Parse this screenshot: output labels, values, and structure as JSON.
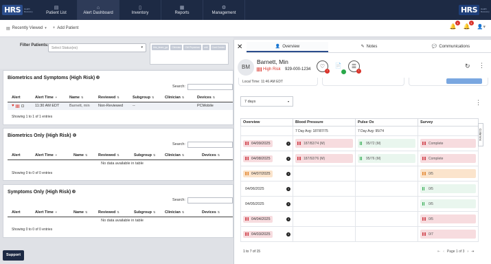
{
  "nav": {
    "logo_text": "HRS",
    "logo_sub": "Health Recovery Solutions",
    "items": [
      {
        "label": "Patient List",
        "icon": "list-icon"
      },
      {
        "label": "Alert Dashboard",
        "icon": "home-icon"
      },
      {
        "label": "Inventory",
        "icon": "tablet-icon"
      },
      {
        "label": "Reports",
        "icon": "chart-icon"
      },
      {
        "label": "Management",
        "icon": "gear-icon"
      }
    ],
    "right_logo": "HRS",
    "right_logo_sub": "Health Recovery Solutions"
  },
  "subbar": {
    "recently_viewed": "Recently Viewed",
    "add_patient": "Add Patient",
    "notif_count_1": "1",
    "notif_count_2": "1"
  },
  "filter": {
    "label": "Filter Patients:",
    "placeholder": "Select Status(es)",
    "chips": [
      "hhs_team_ga",
      "Clinician",
      "CM Physician",
      "unit",
      "Cost Center"
    ]
  },
  "panels": [
    {
      "title": "Biometrics and Symptoms (High Risk)",
      "search_label": "Search:",
      "columns": [
        "Alert",
        "Alert Time",
        "Name",
        "Reviewed",
        "Subgroup",
        "Clinician",
        "Devices"
      ],
      "rows": [
        {
          "alert_time": "11:30 AM EDT",
          "name": "Barnett, min",
          "reviewed": "Non-Reviewed",
          "subgroup": "--",
          "clinician": "",
          "devices": "PCMobile"
        }
      ],
      "showing": "Showing 1 to 1 of 1 entries"
    },
    {
      "title": "Biometrics Only (High Risk)",
      "search_label": "Search:",
      "columns": [
        "Alert",
        "Alert Time",
        "Name",
        "Reviewed",
        "Subgroup",
        "Clinician",
        "Devices"
      ],
      "no_data": "No data available in table",
      "showing": "Showing 0 to 0 of 0 entries"
    },
    {
      "title": "Symptoms Only (High Risk)",
      "search_label": "Search:",
      "columns": [
        "Alert",
        "Alert Time",
        "Name",
        "Reviewed",
        "Subgroup",
        "Clinician",
        "Devices"
      ],
      "no_data": "No data available in table",
      "showing": "Showing 0 to 0 of 0 entries"
    }
  ],
  "support_label": "Support",
  "overlay": {
    "tabs": [
      "Overview",
      "Notes",
      "Communications"
    ],
    "initials": "BM",
    "patient_name": "Barnett, Min",
    "risk": "High Risk",
    "phone": "929-000-1234",
    "status_badges": [
      "!",
      "",
      "!"
    ],
    "local_time": "Local Time: 11:46 AM EDT",
    "days_select": "7 days",
    "columns_tab": "Columns",
    "table": {
      "headers": [
        "Overview",
        "Blood Pressure",
        "Pulse Ox",
        "Survey"
      ],
      "avg": [
        "",
        "7 Day Avg: 187/87/75",
        "7 Day Avg: 95/74",
        ""
      ],
      "rows": [
        {
          "date": "04/09/2025",
          "level": "red",
          "bp": "187/82/74 (M)",
          "bp_level": "red",
          "po": "95/72 (M)",
          "po_level": "green",
          "survey": "Complete",
          "survey_level": "red"
        },
        {
          "date": "04/08/2025",
          "level": "red",
          "bp": "187/92/76 (M)",
          "bp_level": "red",
          "po": "95/76 (M)",
          "po_level": "green",
          "survey": "Complete",
          "survey_level": "red"
        },
        {
          "date": "04/07/2025",
          "level": "orange",
          "bp": "",
          "bp_level": "",
          "po": "",
          "po_level": "",
          "survey": "0/5",
          "survey_level": "orange"
        },
        {
          "date": "04/06/2025",
          "level": "none",
          "bp": "",
          "bp_level": "",
          "po": "",
          "po_level": "",
          "survey": "0/5",
          "survey_level": "green"
        },
        {
          "date": "04/05/2025",
          "level": "none",
          "bp": "",
          "bp_level": "",
          "po": "",
          "po_level": "",
          "survey": "0/5",
          "survey_level": "green"
        },
        {
          "date": "04/04/2025",
          "level": "red",
          "bp": "",
          "bp_level": "",
          "po": "",
          "po_level": "",
          "survey": "0/5",
          "survey_level": "red"
        },
        {
          "date": "04/03/2025",
          "level": "red",
          "bp": "",
          "bp_level": "",
          "po": "",
          "po_level": "",
          "survey": "0/7",
          "survey_level": "red"
        }
      ]
    },
    "pager_info": "1 to 7 of 15",
    "pager_page": "Page 1 of 3"
  }
}
